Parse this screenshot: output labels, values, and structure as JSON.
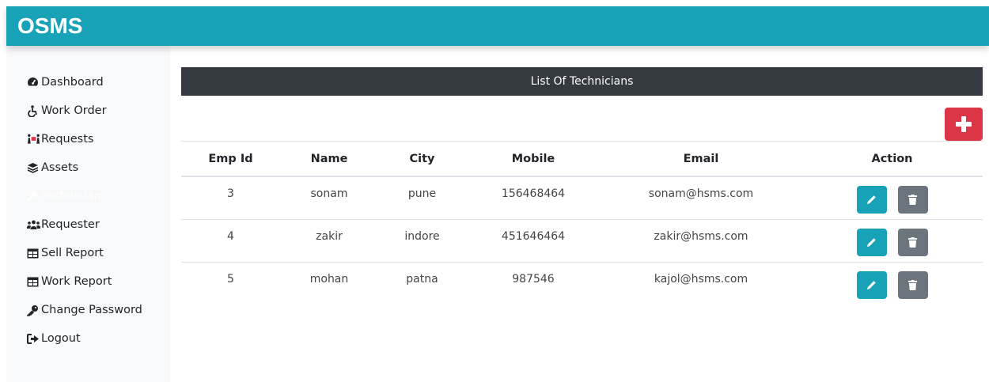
{
  "app": {
    "brand": "OSMS"
  },
  "sidebar": {
    "items": [
      {
        "label": "Dashboard",
        "icon": "tachometer-icon",
        "active": false
      },
      {
        "label": "Work Order",
        "icon": "accessible-icon",
        "active": false
      },
      {
        "label": "Requests",
        "icon": "people-carry-icon",
        "active": false
      },
      {
        "label": "Assets",
        "icon": "layer-group-icon",
        "active": false
      },
      {
        "label": "Technician",
        "icon": "wrench-icon",
        "active": true
      },
      {
        "label": "Requester",
        "icon": "users-icon",
        "active": false
      },
      {
        "label": "Sell Report",
        "icon": "table-icon",
        "active": false
      },
      {
        "label": "Work Report",
        "icon": "table-icon",
        "active": false
      },
      {
        "label": "Change Password",
        "icon": "key-icon",
        "active": false
      },
      {
        "label": "Logout",
        "icon": "sign-out-icon",
        "active": false
      }
    ]
  },
  "main": {
    "title": "List Of Technicians",
    "add_button_icon": "plus-icon",
    "table": {
      "headers": [
        "Emp Id",
        "Name",
        "City",
        "Mobile",
        "Email",
        "Action"
      ],
      "rows": [
        {
          "id": "3",
          "name": "sonam",
          "city": "pune",
          "mobile": "156468464",
          "email": "sonam@hsms.com"
        },
        {
          "id": "4",
          "name": "zakir",
          "city": "indore",
          "mobile": "451646464",
          "email": "zakir@hsms.com"
        },
        {
          "id": "5",
          "name": "mohan",
          "city": "patna",
          "mobile": "987546",
          "email": "kajol@hsms.com"
        }
      ]
    }
  },
  "colors": {
    "header": "#17a2b8",
    "sidebar_bg": "#f8f9fa",
    "title_bar": "#343a40",
    "add_button": "#dc3545",
    "edit_button": "#17a2b8",
    "delete_button": "#6c757d"
  }
}
